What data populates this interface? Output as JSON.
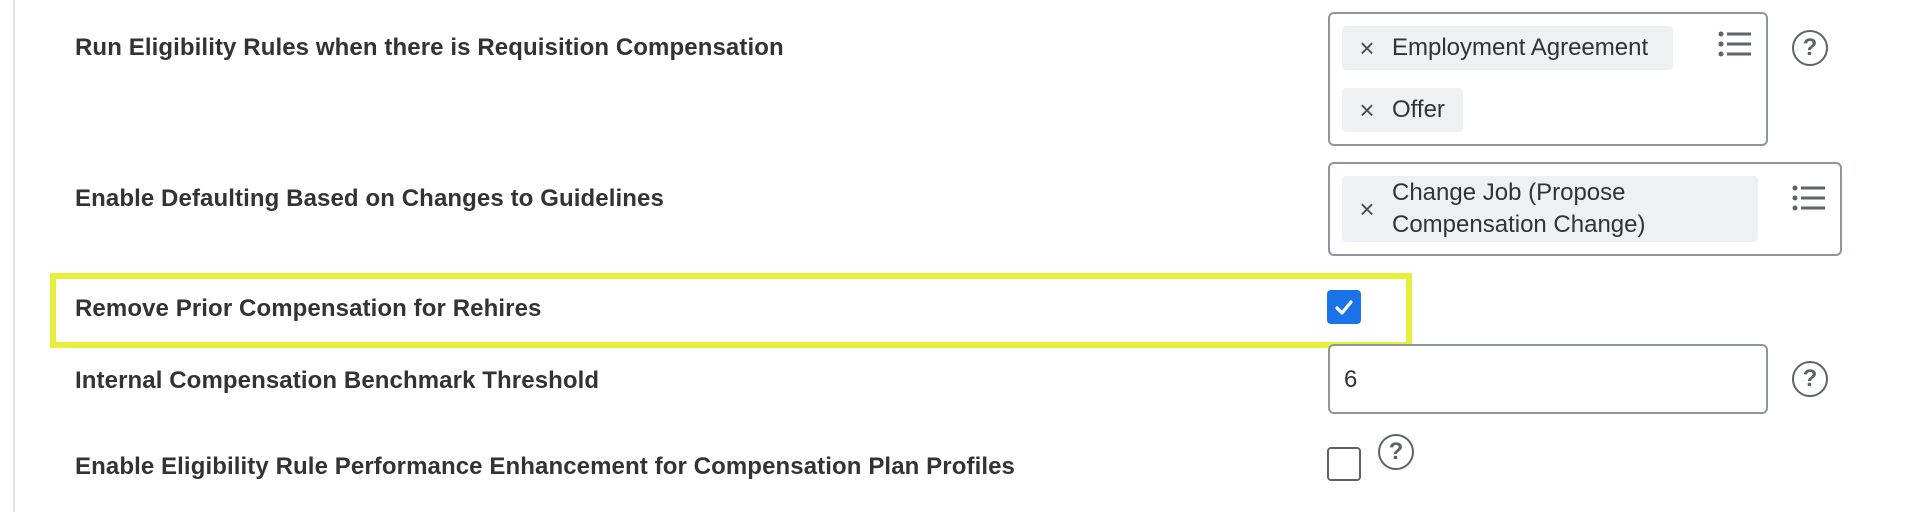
{
  "settings": [
    {
      "label": "Run Eligibility Rules when there is Requisition Compensation",
      "chips": [
        "Employment Agreement",
        "Offer"
      ]
    },
    {
      "label": "Enable Defaulting Based on Changes to Guidelines",
      "chips": [
        "Change Job (Propose Compensation Change)"
      ]
    },
    {
      "label": "Remove Prior Compensation for Rehires",
      "checked": true
    },
    {
      "label": "Internal Compensation Benchmark Threshold",
      "value": "6"
    },
    {
      "label": "Enable Eligibility Rule Performance Enhancement for Compensation Plan Profiles",
      "checked": false
    }
  ],
  "glyphs": {
    "remove": "×",
    "help": "?"
  },
  "colors": {
    "highlight": "#e6f03c",
    "checkbox_checked": "#1a73e8",
    "field_border": "#8e959e"
  }
}
